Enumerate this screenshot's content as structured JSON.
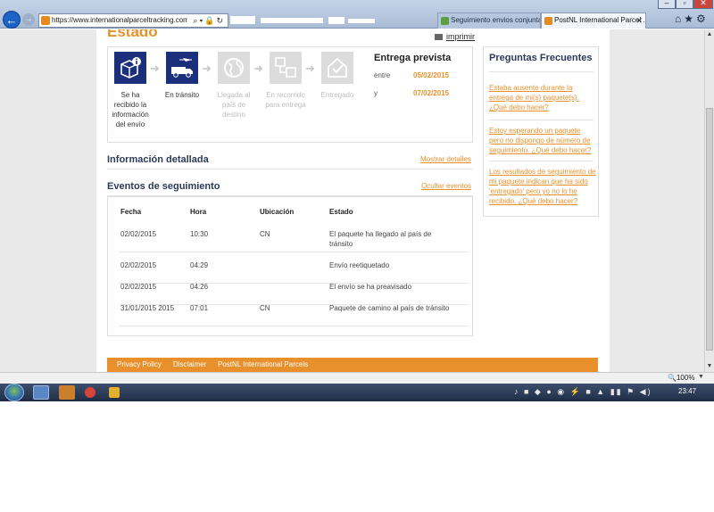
{
  "browser": {
    "url": "https://www.internationalparceltracking.com/Mai",
    "tabs": [
      {
        "label": "Seguimiento envios conjunta ..."
      },
      {
        "label": "PostNL International Parcel ..."
      }
    ],
    "close_glyph": "✕",
    "zoom": "100%"
  },
  "page": {
    "title": "Estado",
    "print_label": "imprimir",
    "steps": [
      {
        "label": "Se ha recibido la información del envío",
        "active": true,
        "icon": "package-info-icon"
      },
      {
        "label": "En tránsito",
        "active": true,
        "icon": "truck-plane-icon"
      },
      {
        "label": "Llegada al país de destino",
        "active": false,
        "icon": "globe-icon"
      },
      {
        "label": "En recorrido para entrega",
        "active": false,
        "icon": "delivery-route-icon"
      },
      {
        "label": "Entregado",
        "active": false,
        "icon": "house-check-icon"
      }
    ],
    "delivery": {
      "title": "Entrega prevista",
      "from_label": "entre",
      "from_date": "05/02/2015",
      "to_label": "y",
      "to_date": "07/02/2015"
    },
    "info": {
      "title": "Información detallada",
      "link": "Mostrar detalles"
    },
    "events": {
      "title": "Eventos de seguimiento",
      "link": "Ocultar eventos",
      "columns": [
        "Fecha",
        "Hora",
        "Ubicación",
        "Estado"
      ],
      "rows": [
        {
          "date": "02/02/2015",
          "time": "10:30",
          "location": "CN",
          "status": "El paquete ha llegado al país de tránsito"
        },
        {
          "date": "02/02/2015",
          "time": "04:29",
          "location": "",
          "status": "Envío reetiquetado"
        },
        {
          "date": "02/02/2015",
          "time": "04:26",
          "location": "",
          "status": "El envío se ha preavisado"
        },
        {
          "date": "31/01/2015 2015",
          "time": "07:01",
          "location": "CN",
          "status": "Paquete de camino al país de tránsito"
        }
      ]
    },
    "faq": {
      "title": "Preguntas Frecuentes",
      "items": [
        "Estaba ausente durante la entrega de mi(s) paquete(s). ¿Qué debo hacer?",
        "Estoy esperando un paquete pero no dispongo de número de seguimiento. ¿Qué debo hacer?",
        "Los resultados de seguimiento de mi paquete indican que ha sido 'entregado' pero yo no lo he recibido. ¿Qué debo hacer?"
      ]
    },
    "footer": {
      "links": [
        "Privacy Policy",
        "Disclaimer",
        "PostNL International Parcels"
      ]
    }
  },
  "taskbar": {
    "clock": "23:47"
  },
  "colors": {
    "accent": "#e8912c",
    "active_step": "#1b2f7a",
    "inactive_step": "#dcdcdc",
    "heading": "#2b3a57"
  }
}
